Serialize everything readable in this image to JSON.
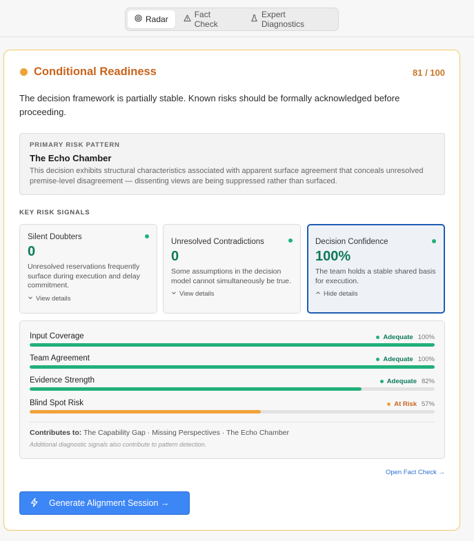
{
  "tabs": [
    {
      "label": "Radar",
      "icon": "radar-icon",
      "active": true
    },
    {
      "label": "Fact Check",
      "icon": "warning-triangle-icon",
      "active": false
    },
    {
      "label": "Expert Diagnostics",
      "icon": "flask-icon",
      "active": false
    }
  ],
  "readiness": {
    "title": "Conditional Readiness",
    "score": "81 / 100",
    "status_color": "#f0a23a",
    "summary": "The decision framework is partially stable. Known risks should be formally acknowledged before proceeding."
  },
  "primary_risk": {
    "label": "PRIMARY RISK PATTERN",
    "name": "The Echo Chamber",
    "description": "This decision exhibits structural characteristics associated with apparent surface agreement that conceals unresolved premise-level disagreement — dissenting views are being suppressed rather than surfaced."
  },
  "signals": {
    "label": "KEY RISK SIGNALS",
    "items": [
      {
        "title": "Silent Doubters",
        "value": "0",
        "description": "Unresolved reservations frequently surface during execution and delay commitment.",
        "toggle": "View details",
        "expanded": false
      },
      {
        "title": "Unresolved Contradictions",
        "value": "0",
        "description": "Some assumptions in the decision model cannot simultaneously be true.",
        "toggle": "View details",
        "expanded": false
      },
      {
        "title": "Decision Confidence",
        "value": "100%",
        "description": "The team holds a stable shared basis for execution.",
        "toggle": "Hide details",
        "expanded": true
      }
    ]
  },
  "metrics": [
    {
      "name": "Input Coverage",
      "status": "Adequate",
      "percent": "100%",
      "value": 100,
      "color": "#22b07a"
    },
    {
      "name": "Team Agreement",
      "status": "Adequate",
      "percent": "100%",
      "value": 100,
      "color": "#22b07a"
    },
    {
      "name": "Evidence Strength",
      "status": "Adequate",
      "percent": "82%",
      "value": 82,
      "color": "#22b07a"
    },
    {
      "name": "Blind Spot Risk",
      "status": "At Risk",
      "percent": "57%",
      "value": 57,
      "color": "#f0a23a"
    }
  ],
  "contributes": {
    "label": "Contributes to:",
    "text": "The Capability Gap · Missing Perspectives · The Echo Chamber",
    "note": "Additional diagnostic signals also contribute to pattern detection."
  },
  "fact_check_link": "Open Fact Check →",
  "generate_button": "Generate Alignment Session →",
  "colors": {
    "accent": "#3d86f5",
    "adequate": "#22b07a",
    "at_risk": "#f0a23a",
    "at_risk_text": "#c8641c"
  }
}
